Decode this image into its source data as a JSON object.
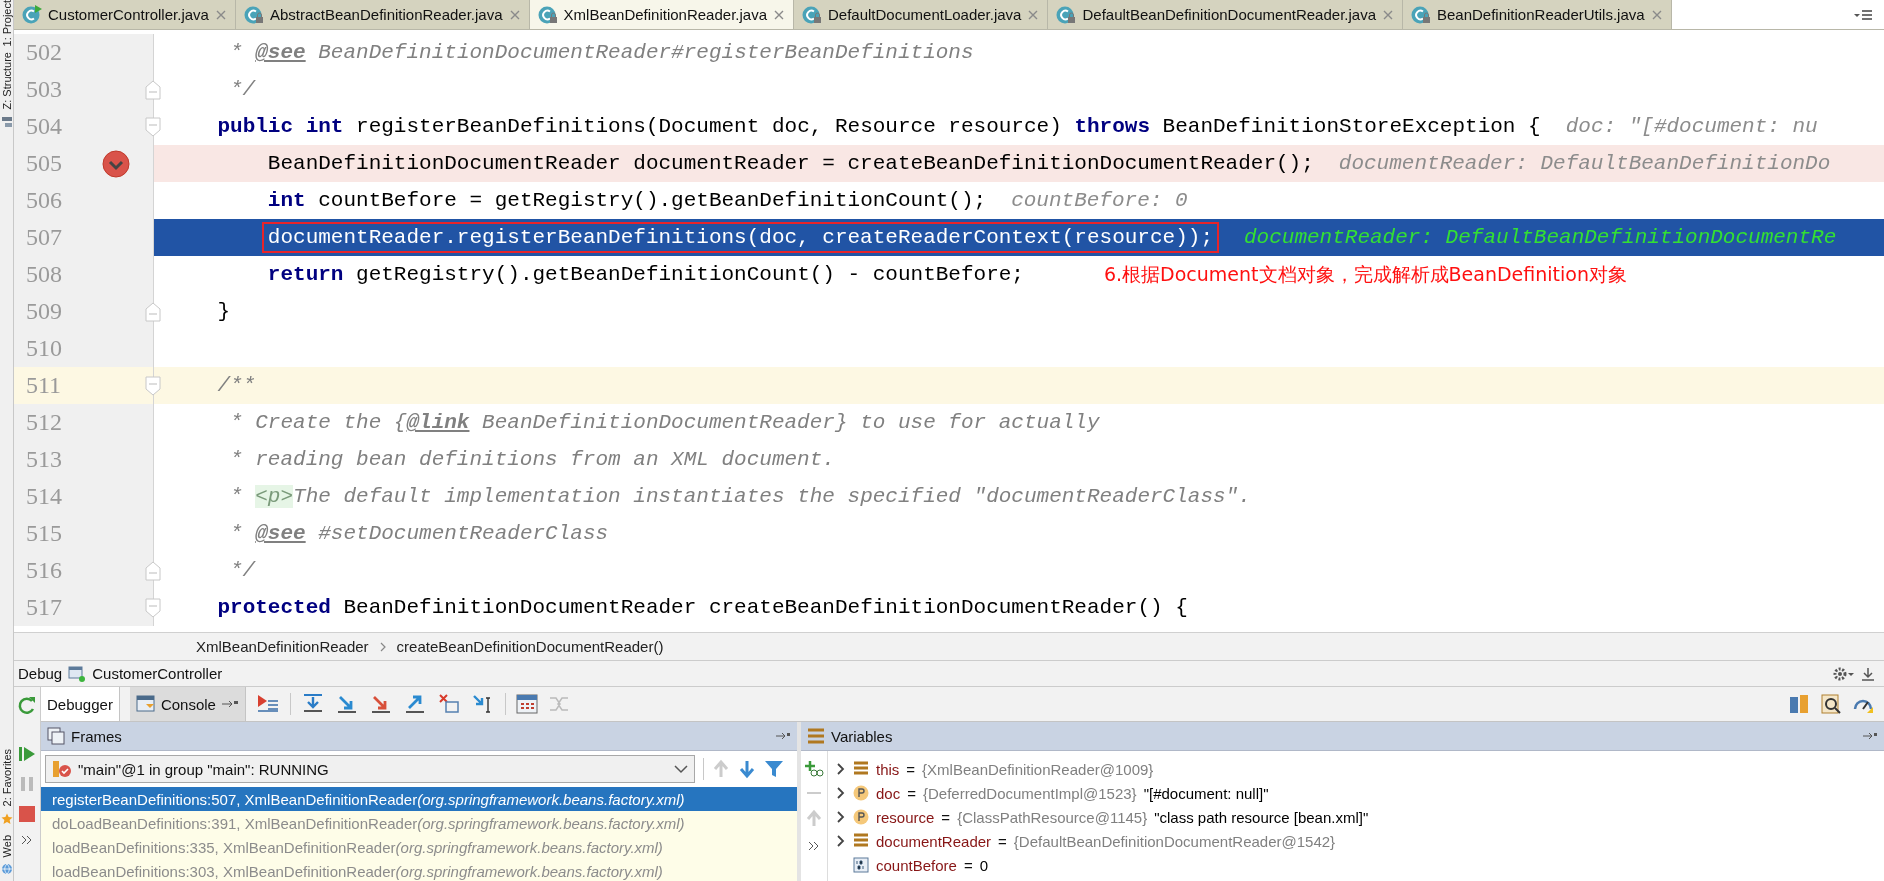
{
  "side_strip": {
    "top": [
      {
        "label": "1: Project",
        "kind": "project"
      },
      {
        "label": "Z: Structure",
        "kind": "structure"
      }
    ],
    "bottom": [
      {
        "label": "2: Favorites",
        "kind": "favorites"
      },
      {
        "label": "Web",
        "kind": "web"
      }
    ]
  },
  "tabs": [
    {
      "label": "CustomerController.java",
      "kind": "runnable",
      "selected": false
    },
    {
      "label": "AbstractBeanDefinitionReader.java",
      "kind": "library",
      "selected": false
    },
    {
      "label": "XmlBeanDefinitionReader.java",
      "kind": "library",
      "selected": true
    },
    {
      "label": "DefaultDocumentLoader.java",
      "kind": "library",
      "selected": false
    },
    {
      "label": "DefaultBeanDefinitionDocumentReader.java",
      "kind": "library",
      "selected": false
    },
    {
      "label": "BeanDefinitionReaderUtils.java",
      "kind": "library",
      "selected": false
    }
  ],
  "editor": {
    "lines": [
      {
        "number": "502",
        "breakpoint": false,
        "execution": false,
        "caret": false,
        "fold_start": false,
        "fold_end": false,
        "boxed": false,
        "segments": [
          {
            "kind": "comment",
            "text": "     * "
          },
          {
            "kind": "doc-tag",
            "text": "@see"
          },
          {
            "kind": "comment",
            "text": " BeanDefinitionDocumentReader#registerBeanDefinitions"
          }
        ]
      },
      {
        "number": "503",
        "breakpoint": false,
        "execution": false,
        "caret": false,
        "fold_start": false,
        "fold_end": true,
        "boxed": false,
        "segments": [
          {
            "kind": "comment",
            "text": "     */"
          }
        ]
      },
      {
        "number": "504",
        "breakpoint": false,
        "execution": false,
        "caret": false,
        "fold_start": true,
        "fold_end": false,
        "boxed": false,
        "segments": [
          {
            "kind": "keyword",
            "text": "    public int"
          },
          {
            "kind": "plain",
            "text": " registerBeanDefinitions(Document doc, Resource resource) "
          },
          {
            "kind": "keyword",
            "text": "throws"
          },
          {
            "kind": "plain",
            "text": " BeanDefinitionStoreException {"
          }
        ],
        "hint": "doc: \"[#document: nu"
      },
      {
        "number": "505",
        "breakpoint": true,
        "execution": false,
        "caret": false,
        "fold_start": false,
        "fold_end": false,
        "boxed": false,
        "segments": [
          {
            "kind": "plain",
            "text": "        BeanDefinitionDocumentReader documentReader = createBeanDefinitionDocumentReader();"
          }
        ],
        "hint": "documentReader: DefaultBeanDefinitionDo"
      },
      {
        "number": "506",
        "breakpoint": false,
        "execution": false,
        "caret": false,
        "fold_start": false,
        "fold_end": false,
        "boxed": false,
        "segments": [
          {
            "kind": "keyword",
            "text": "        int"
          },
          {
            "kind": "plain",
            "text": " countBefore = getRegistry().getBeanDefinitionCount();"
          }
        ],
        "hint": "countBefore: 0"
      },
      {
        "number": "507",
        "breakpoint": false,
        "execution": true,
        "caret": false,
        "fold_start": false,
        "fold_end": false,
        "boxed": true,
        "segments": [
          {
            "kind": "plain",
            "text": "        documentReader.registerBeanDefinitions(doc, createReaderContext(resource));"
          }
        ],
        "hint": "documentReader: DefaultBeanDefinitionDocumentRe"
      },
      {
        "number": "508",
        "breakpoint": false,
        "execution": false,
        "caret": false,
        "fold_start": false,
        "fold_end": false,
        "boxed": false,
        "segments": [
          {
            "kind": "keyword",
            "text": "        return"
          },
          {
            "kind": "plain",
            "text": " getRegistry().getBeanDefinitionCount() - countBefore;"
          }
        ],
        "note": "6.根据Document文档对象，完成解析成BeanDefinition对象"
      },
      {
        "number": "509",
        "breakpoint": false,
        "execution": false,
        "caret": false,
        "fold_start": false,
        "fold_end": true,
        "boxed": false,
        "segments": [
          {
            "kind": "plain",
            "text": "    }"
          }
        ]
      },
      {
        "number": "510",
        "breakpoint": false,
        "execution": false,
        "caret": false,
        "fold_start": false,
        "fold_end": false,
        "boxed": false
      },
      {
        "number": "511",
        "breakpoint": false,
        "execution": false,
        "caret": true,
        "fold_start": true,
        "fold_end": false,
        "boxed": false,
        "segments": [
          {
            "kind": "comment",
            "text": "    /**"
          }
        ]
      },
      {
        "number": "512",
        "breakpoint": false,
        "execution": false,
        "caret": false,
        "fold_start": false,
        "fold_end": false,
        "boxed": false,
        "segments": [
          {
            "kind": "comment",
            "text": "     * Create the {"
          },
          {
            "kind": "doc-tag",
            "text": "@link"
          },
          {
            "kind": "comment",
            "text": " BeanDefinitionDocumentReader} to use for actually"
          }
        ]
      },
      {
        "number": "513",
        "breakpoint": false,
        "execution": false,
        "caret": false,
        "fold_start": false,
        "fold_end": false,
        "boxed": false,
        "segments": [
          {
            "kind": "comment",
            "text": "     * reading bean definitions from an XML document."
          }
        ]
      },
      {
        "number": "514",
        "breakpoint": false,
        "execution": false,
        "caret": false,
        "fold_start": false,
        "fold_end": false,
        "boxed": false,
        "segments": [
          {
            "kind": "comment",
            "text": "     * "
          },
          {
            "kind": "html-tag",
            "text": "<p>"
          },
          {
            "kind": "comment",
            "text": "The default implementation instantiates the specified \"documentReaderClass\"."
          }
        ]
      },
      {
        "number": "515",
        "breakpoint": false,
        "execution": false,
        "caret": false,
        "fold_start": false,
        "fold_end": false,
        "boxed": false,
        "segments": [
          {
            "kind": "comment",
            "text": "     * "
          },
          {
            "kind": "doc-tag",
            "text": "@see"
          },
          {
            "kind": "comment",
            "text": " #setDocumentReaderClass"
          }
        ]
      },
      {
        "number": "516",
        "breakpoint": false,
        "execution": false,
        "caret": false,
        "fold_start": false,
        "fold_end": true,
        "boxed": false,
        "segments": [
          {
            "kind": "comment",
            "text": "     */"
          }
        ]
      },
      {
        "number": "517",
        "breakpoint": false,
        "execution": false,
        "caret": false,
        "fold_start": true,
        "fold_end": false,
        "boxed": false,
        "segments": [
          {
            "kind": "keyword",
            "text": "    protected"
          },
          {
            "kind": "plain",
            "text": " BeanDefinitionDocumentReader createBeanDefinitionDocumentReader() {"
          }
        ]
      }
    ]
  },
  "breadcrumb": [
    "XmlBeanDefinitionReader",
    "createBeanDefinitionDocumentReader()"
  ],
  "debug": {
    "title": "Debug",
    "config": "CustomerController",
    "tabs": [
      {
        "label": "Debugger",
        "selected": true
      },
      {
        "label": "Console",
        "selected": false
      }
    ],
    "frames": {
      "title": "Frames",
      "thread": "\"main\"@1 in group \"main\": RUNNING",
      "items": [
        {
          "method": "registerBeanDefinitions:507, XmlBeanDefinitionReader",
          "package": "(org.springframework.beans.factory.xml)",
          "selected": true
        },
        {
          "method": "doLoadBeanDefinitions:391, XmlBeanDefinitionReader",
          "package": "(org.springframework.beans.factory.xml)",
          "selected": false
        },
        {
          "method": "loadBeanDefinitions:335, XmlBeanDefinitionReader",
          "package": "(org.springframework.beans.factory.xml)",
          "selected": false
        },
        {
          "method": "loadBeanDefinitions:303, XmlBeanDefinitionReader",
          "package": "(org.springframework.beans.factory.xml)",
          "selected": false
        }
      ]
    },
    "variables": {
      "title": "Variables",
      "items": [
        {
          "name": "this",
          "kind": "field",
          "expandable": true,
          "equals": "=",
          "ref": "{XmlBeanDefinitionReader@1009}"
        },
        {
          "name": "doc",
          "kind": "param",
          "expandable": true,
          "equals": "=",
          "ref": "{DeferredDocumentImpl@1523}",
          "text": "\"[#document: null]\""
        },
        {
          "name": "resource",
          "kind": "param",
          "expandable": true,
          "equals": "=",
          "ref": "{ClassPathResource@1145}",
          "text": "\"class path resource [bean.xml]\""
        },
        {
          "name": "documentReader",
          "kind": "field",
          "expandable": true,
          "equals": "=",
          "ref": "{DefaultBeanDefinitionDocumentReader@1542}"
        },
        {
          "name": "countBefore",
          "kind": "primitive",
          "expandable": false,
          "equals": "=",
          "text": "0"
        }
      ]
    }
  }
}
